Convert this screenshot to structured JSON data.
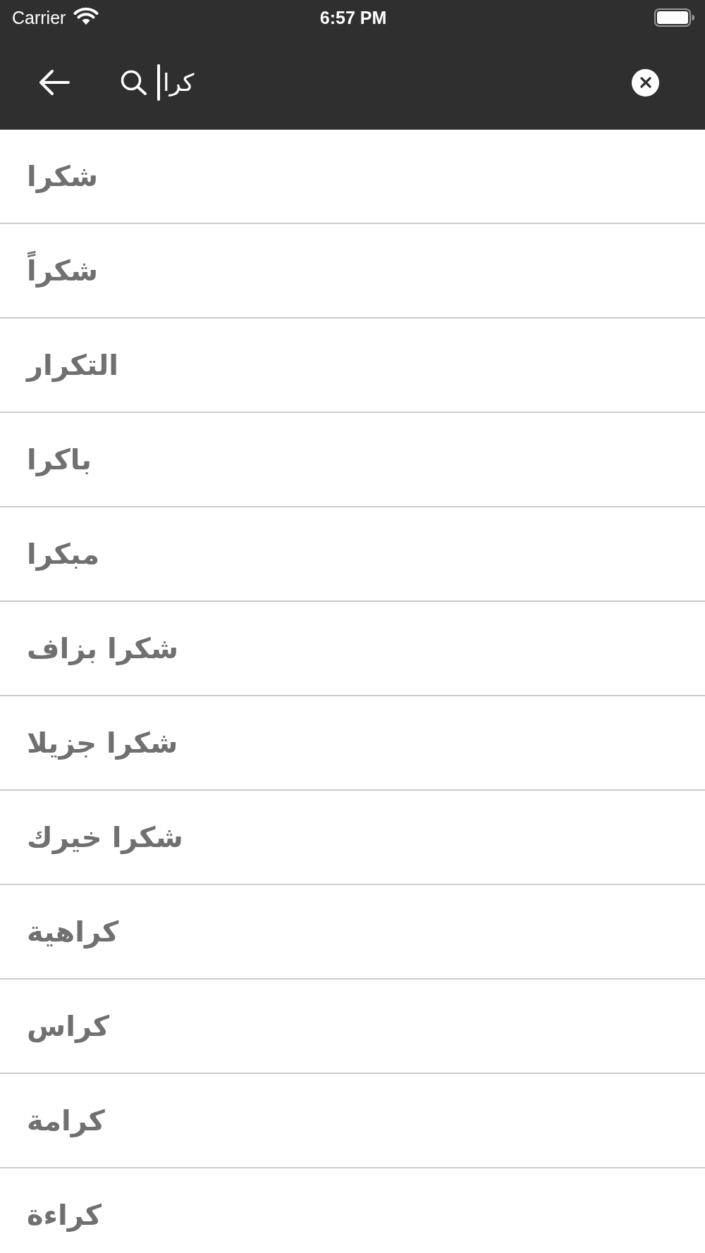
{
  "status_bar": {
    "carrier": "Carrier",
    "time": "6:57 PM"
  },
  "search": {
    "value": "كرا"
  },
  "results": [
    "شكرا",
    "شكراً",
    "التكرار",
    "باكرا",
    "مبكرا",
    "شكرا بزاف",
    "شكرا جزيلا",
    "شكرا خيرك",
    "كراهية",
    "كراس",
    "كرامة",
    "كراءة"
  ]
}
